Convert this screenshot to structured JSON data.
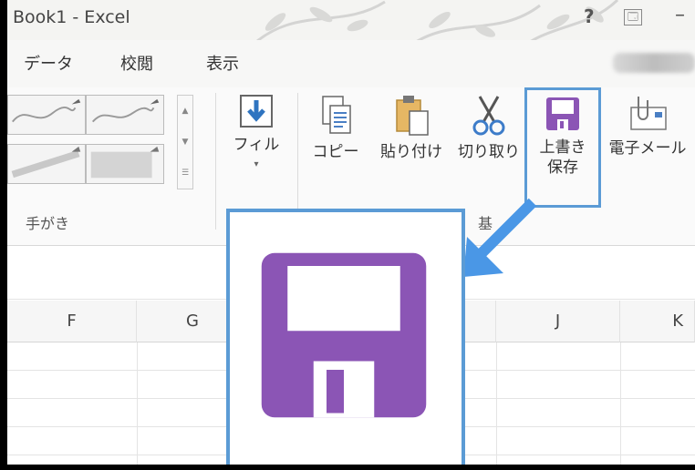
{
  "window": {
    "title": "Book1 - Excel",
    "help_label": "?",
    "ribbon_options_label": "🗔",
    "minimize_label": "–"
  },
  "tabs": [
    {
      "label": "データ"
    },
    {
      "label": "校閲"
    },
    {
      "label": "表示"
    }
  ],
  "ribbon": {
    "ink_group_label": "手がき",
    "fill_label": "フィル",
    "fill_dropdown": "▾",
    "copy_label": "コピー",
    "paste_label": "貼り付け",
    "cut_label": "切り取り",
    "save_label_line1": "上書き",
    "save_label_line2": "保存",
    "email_label": "電子メール",
    "basic_group_label_fragment": "基"
  },
  "grid": {
    "columns": [
      "F",
      "G",
      "J",
      "K"
    ]
  },
  "colors": {
    "save_purple": "#8b55b5",
    "highlight_blue": "#5b9bd5",
    "fill_arrow_blue": "#2f74c0"
  }
}
